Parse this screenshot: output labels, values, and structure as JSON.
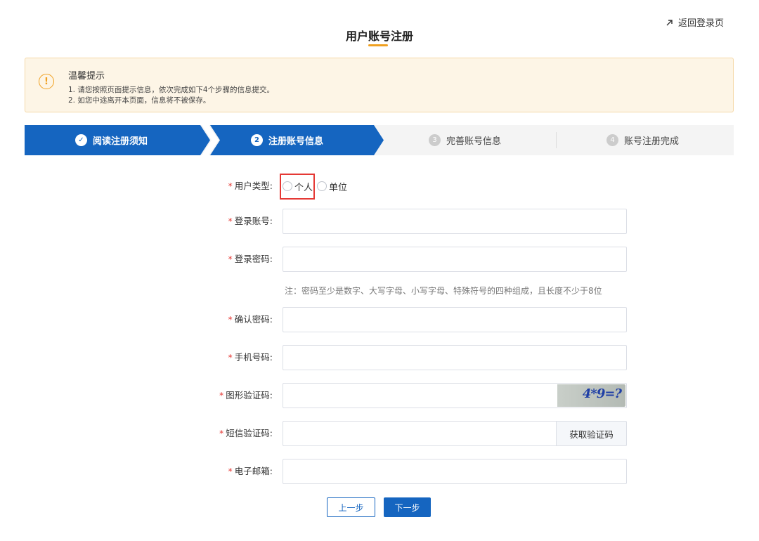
{
  "header": {
    "back_link": "返回登录页",
    "title": "用户账号注册"
  },
  "notice": {
    "title": "温馨提示",
    "icon": "warning-icon",
    "lines": [
      "1. 请您按照页面提示信息，依次完成如下4个步骤的信息提交。",
      "2. 如您中途离开本页面，信息将不被保存。"
    ]
  },
  "steps": [
    {
      "num": "✓",
      "label": "阅读注册须知",
      "state": "done"
    },
    {
      "num": "2",
      "label": "注册账号信息",
      "state": "current"
    },
    {
      "num": "3",
      "label": "完善账号信息",
      "state": "pending"
    },
    {
      "num": "4",
      "label": "账号注册完成",
      "state": "pending"
    }
  ],
  "form": {
    "user_type": {
      "label": "用户类型:",
      "options": [
        "个人",
        "单位"
      ]
    },
    "login_account": {
      "label": "登录账号:",
      "value": ""
    },
    "login_password": {
      "label": "登录密码:",
      "value": ""
    },
    "password_hint": "注：密码至少是数字、大写字母、小写字母、特殊符号的四种组成，且长度不少于8位",
    "confirm_password": {
      "label": "确认密码:",
      "value": ""
    },
    "phone": {
      "label": "手机号码:",
      "value": ""
    },
    "captcha": {
      "label": "图形验证码:",
      "value": "",
      "image_text": "4*9=?"
    },
    "sms_code": {
      "label": "短信验证码:",
      "value": "",
      "button": "获取验证码"
    },
    "email": {
      "label": "电子邮箱:",
      "value": ""
    }
  },
  "actions": {
    "prev": "上一步",
    "next": "下一步"
  },
  "colors": {
    "primary": "#1565c0",
    "accent": "#f0a020",
    "required": "#e53935"
  }
}
